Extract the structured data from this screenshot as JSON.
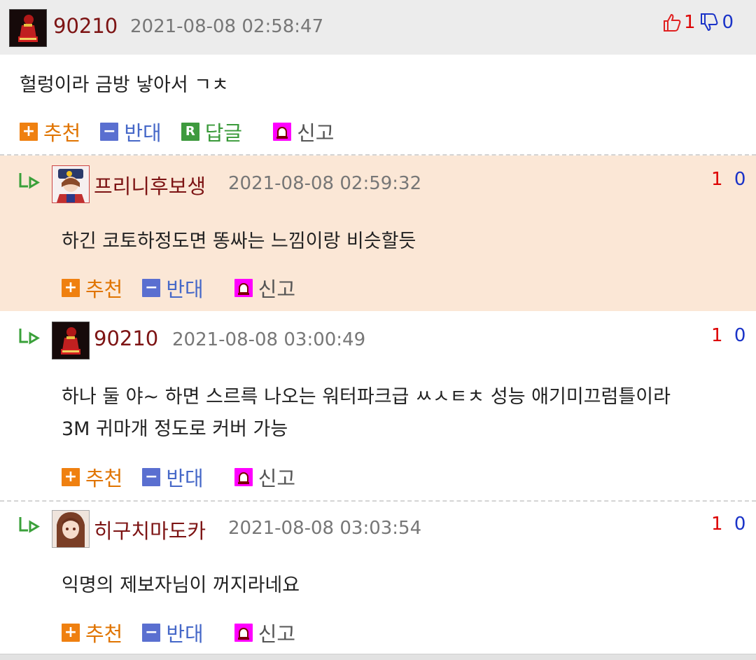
{
  "main_comment": {
    "nickname": "90210",
    "date": "2021-08-08 02:58:47",
    "up_count": "1",
    "down_count": "0",
    "body": "헐렁이라 금방 낳아서 ㄱㅊ",
    "actions": {
      "recommend": "추천",
      "oppose": "반대",
      "reply": "답글",
      "report": "신고"
    }
  },
  "replies": [
    {
      "nickname": "프리니후보생",
      "date": "2021-08-08 02:59:32",
      "up_count": "1",
      "down_count": "0",
      "body_lines": [
        "하긴 코토하정도면 똥싸는 느낌이랑 비슷할듯"
      ],
      "actions": {
        "recommend": "추천",
        "oppose": "반대",
        "report": "신고"
      }
    },
    {
      "nickname": "90210",
      "date": "2021-08-08 03:00:49",
      "up_count": "1",
      "down_count": "0",
      "body_lines": [
        "하나 둘 야~ 하면 스르륵 나오는 워터파크급 ㅆㅅㅌㅊ 성능 애기미끄럼틀이라",
        "3M 귀마개 정도로 커버 가능"
      ],
      "actions": {
        "recommend": "추천",
        "oppose": "반대",
        "report": "신고"
      }
    },
    {
      "nickname": "히구치마도카",
      "date": "2021-08-08 03:03:54",
      "up_count": "1",
      "down_count": "0",
      "body_lines": [
        "익명의 제보자님이 꺼지라네요"
      ],
      "actions": {
        "recommend": "추천",
        "oppose": "반대",
        "report": "신고"
      }
    }
  ],
  "icons": {
    "plus_badge": "+",
    "minus_badge": "−",
    "reply_badge": "R",
    "reply_arrow": "reply-arrow-icon",
    "thumbs_up": "thumbs-up-icon",
    "thumbs_down": "thumbs-down-icon",
    "report": "siren-icon"
  },
  "colors": {
    "nickname": "#7d1414",
    "recommend": "#e07400",
    "oppose": "#4668c8",
    "reply": "#3a9a3a",
    "reply_highlight_bg": "#fbe7d6",
    "header_bg": "#ececec",
    "vote_up": "#dd0000",
    "vote_down": "#1a33c8"
  }
}
